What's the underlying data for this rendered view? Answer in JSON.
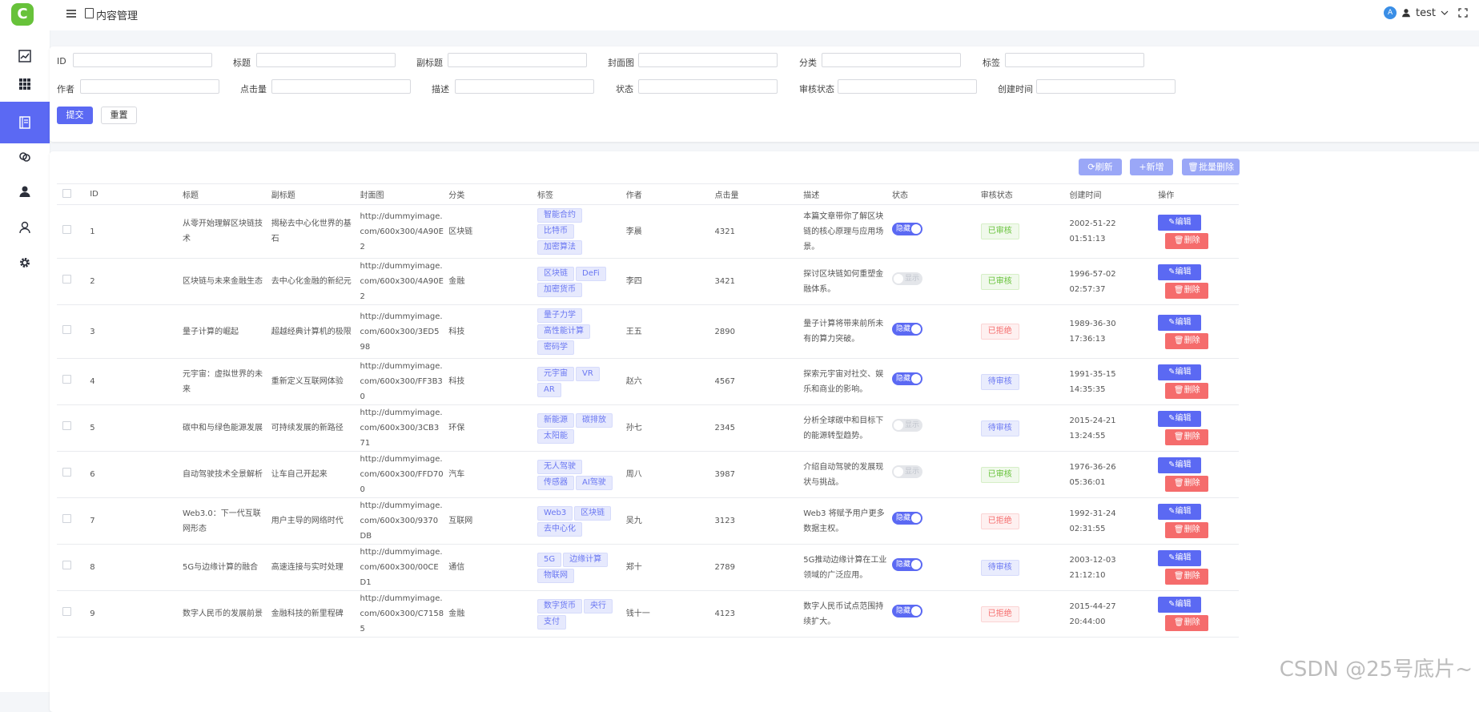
{
  "app": {
    "logo_letter": "C"
  },
  "header": {
    "breadcrumb": "内容管理",
    "user": "test"
  },
  "sidebar": {
    "items": [
      {
        "icon": "chart-icon"
      },
      {
        "icon": "grid-icon"
      },
      {
        "icon": "document-icon",
        "active": true
      },
      {
        "icon": "link-icon"
      },
      {
        "icon": "user-icon"
      },
      {
        "icon": "user-outline-icon"
      },
      {
        "icon": "gear-icon"
      }
    ]
  },
  "search": {
    "labels": {
      "id": "ID",
      "title": "标题",
      "subtitle": "副标题",
      "cover": "封面图",
      "category": "分类",
      "tags": "标签",
      "author": "作者",
      "clicks": "点击量",
      "desc": "描述",
      "status": "状态",
      "audit": "审核状态",
      "created": "创建时间"
    },
    "submit": "提交",
    "reset": "重置"
  },
  "toolbar": {
    "refresh": "刷新",
    "add": "新增",
    "batch_delete": "批量删除"
  },
  "table": {
    "columns": [
      "ID",
      "标题",
      "副标题",
      "封面图",
      "分类",
      "标签",
      "作者",
      "点击量",
      "描述",
      "状态",
      "审核状态",
      "创建时间",
      "操作"
    ],
    "edit_label": "编辑",
    "delete_label": "删除",
    "switch_on": "隐藏",
    "switch_off": "显示",
    "rows": [
      {
        "id": "1",
        "title": "从零开始理解区块链技术",
        "subtitle": "揭秘去中心化世界的基石",
        "cover": "http://dummyimage.com/600x300/4A90E2",
        "category": "区块链",
        "tags": [
          "智能合约",
          "比特币",
          "加密算法"
        ],
        "author": "李晨",
        "clicks": "4321",
        "desc": "本篇文章带你了解区块链的核心原理与应用场景。",
        "status": "on",
        "audit": "已审核",
        "audit_type": "pass",
        "created": "2002-51-22 01:51:13"
      },
      {
        "id": "2",
        "title": "区块链与未来金融生态",
        "subtitle": "去中心化金融的新纪元",
        "cover": "http://dummyimage.com/600x300/4A90E2",
        "category": "金融",
        "tags": [
          "区块链",
          "DeFi",
          "加密货币"
        ],
        "author": "李四",
        "clicks": "3421",
        "desc": "探讨区块链如何重塑金融体系。",
        "status": "off",
        "audit": "已审核",
        "audit_type": "pass",
        "created": "1996-57-02 02:57:37"
      },
      {
        "id": "3",
        "title": "量子计算的崛起",
        "subtitle": "超越经典计算机的极限",
        "cover": "http://dummyimage.com/600x300/3ED598",
        "category": "科技",
        "tags": [
          "量子力学",
          "高性能计算",
          "密码学"
        ],
        "author": "王五",
        "clicks": "2890",
        "desc": "量子计算将带来前所未有的算力突破。",
        "status": "on",
        "audit": "已拒绝",
        "audit_type": "reject",
        "created": "1989-36-30 17:36:13"
      },
      {
        "id": "4",
        "title": "元宇宙：虚拟世界的未来",
        "subtitle": "重新定义互联网体验",
        "cover": "http://dummyimage.com/600x300/FF3B30",
        "category": "科技",
        "tags": [
          "元宇宙",
          "VR",
          "AR"
        ],
        "author": "赵六",
        "clicks": "4567",
        "desc": "探索元宇宙对社交、娱乐和商业的影响。",
        "status": "on",
        "audit": "待审核",
        "audit_type": "pending",
        "created": "1991-35-15 14:35:35"
      },
      {
        "id": "5",
        "title": "碳中和与绿色能源发展",
        "subtitle": "可持续发展的新路径",
        "cover": "http://dummyimage.com/600x300/3CB371",
        "category": "环保",
        "tags": [
          "新能源",
          "碳排放",
          "太阳能"
        ],
        "author": "孙七",
        "clicks": "2345",
        "desc": "分析全球碳中和目标下的能源转型趋势。",
        "status": "off",
        "audit": "待审核",
        "audit_type": "pending",
        "created": "2015-24-21 13:24:55"
      },
      {
        "id": "6",
        "title": "自动驾驶技术全景解析",
        "subtitle": "让车自己开起来",
        "cover": "http://dummyimage.com/600x300/FFD700",
        "category": "汽车",
        "tags": [
          "无人驾驶",
          "传感器",
          "AI驾驶"
        ],
        "author": "周八",
        "clicks": "3987",
        "desc": "介绍自动驾驶的发展现状与挑战。",
        "status": "off",
        "audit": "已审核",
        "audit_type": "pass",
        "created": "1976-36-26 05:36:01"
      },
      {
        "id": "7",
        "title": "Web3.0：下一代互联网形态",
        "subtitle": "用户主导的网络时代",
        "cover": "http://dummyimage.com/600x300/9370DB",
        "category": "互联网",
        "tags": [
          "Web3",
          "区块链",
          "去中心化"
        ],
        "author": "吴九",
        "clicks": "3123",
        "desc": "Web3 将赋予用户更多数据主权。",
        "status": "on",
        "audit": "已拒绝",
        "audit_type": "reject",
        "created": "1992-31-24 02:31:55"
      },
      {
        "id": "8",
        "title": "5G与边缘计算的融合",
        "subtitle": "高速连接与实时处理",
        "cover": "http://dummyimage.com/600x300/00CED1",
        "category": "通信",
        "tags": [
          "5G",
          "边缘计算",
          "物联网"
        ],
        "author": "郑十",
        "clicks": "2789",
        "desc": "5G推动边缘计算在工业领域的广泛应用。",
        "status": "on",
        "audit": "待审核",
        "audit_type": "pending",
        "created": "2003-12-03 21:12:10"
      },
      {
        "id": "9",
        "title": "数字人民币的发展前景",
        "subtitle": "金融科技的新里程碑",
        "cover": "http://dummyimage.com/600x300/C71585",
        "category": "金融",
        "tags": [
          "数字货币",
          "央行",
          "支付"
        ],
        "author": "钱十一",
        "clicks": "4123",
        "desc": "数字人民币试点范围持续扩大。",
        "status": "on",
        "audit": "已拒绝",
        "audit_type": "reject",
        "created": "2015-44-27 20:44:00"
      }
    ]
  },
  "watermark": "CSDN @25号底片~"
}
